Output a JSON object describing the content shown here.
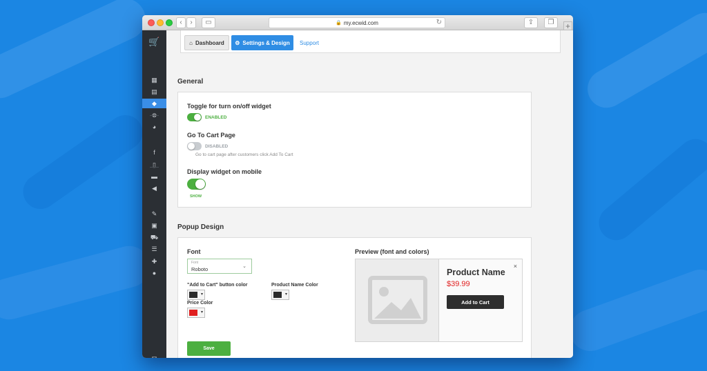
{
  "browser": {
    "url": "my.ecwid.com",
    "back_icon": "‹",
    "forward_icon": "›",
    "sidebar_toggle_icon": "▭",
    "reload_icon": "↻",
    "share_icon": "⇪",
    "tabs_icon": "❐",
    "new_tab_icon": "+"
  },
  "sidebar": {
    "logo_icon": "🛒",
    "items": [
      {
        "name": "store-icon",
        "glyph": "▦"
      },
      {
        "name": "catalog-icon",
        "glyph": "▤"
      },
      {
        "name": "tag-icon",
        "glyph": "◆",
        "active": true
      },
      {
        "name": "marketing-icon",
        "glyph": "⊗"
      },
      {
        "name": "reports-icon",
        "glyph": "◕"
      },
      {
        "name": "facebook-icon",
        "glyph": "f"
      },
      {
        "name": "mobile-icon",
        "glyph": "▯"
      },
      {
        "name": "pos-icon",
        "glyph": "▬"
      },
      {
        "name": "announce-icon",
        "glyph": "◀"
      },
      {
        "name": "design-brush-icon",
        "glyph": "✎"
      },
      {
        "name": "payment-icon",
        "glyph": "▣"
      },
      {
        "name": "shipping-icon",
        "glyph": "⛟"
      },
      {
        "name": "settings-sliders-icon",
        "glyph": "☰"
      },
      {
        "name": "apps-puzzle-icon",
        "glyph": "✚"
      },
      {
        "name": "account-icon",
        "glyph": "●"
      }
    ],
    "mail_icon": "✉"
  },
  "topnav": {
    "dashboard_icon": "⌂",
    "dashboard_label": "Dashboard",
    "settings_icon": "⚙",
    "settings_label": "Settings & Design",
    "support_label": "Support"
  },
  "general": {
    "title": "General",
    "toggle_widget": {
      "label": "Toggle for turn on/off widget",
      "state": "ENABLED",
      "on": true
    },
    "cart_page": {
      "label": "Go To Cart Page",
      "state": "DISABLED",
      "on": false,
      "hint": "Go to cart page after customers click Add To Cart"
    },
    "mobile": {
      "label": "Display widget on mobile",
      "state": "SHOW",
      "on": true
    }
  },
  "popup": {
    "title": "Popup Design",
    "font_label": "Font",
    "font_select_caption": "Font",
    "font_select_value": "Roboto",
    "chevron_icon": "⌄",
    "add_to_cart_color_label": "\"Add to Cart\" button color",
    "add_to_cart_color": "#2b2b2b",
    "product_name_color_label": "Product Name Color",
    "product_name_color": "#2b2b2b",
    "price_color_label": "Price Color",
    "price_color": "#e02020",
    "dropdown_arrow": "▾",
    "save_label": "Save",
    "preview": {
      "title": "Preview (font and colors)",
      "product_name": "Product Name",
      "price": "$39.99",
      "button_label": "Add to Cart",
      "close_icon": "×"
    }
  },
  "colors": {
    "accent": "#2f8de4",
    "toggle_on": "#4caf40",
    "toggle_off": "#c8ccd0",
    "desktop_bg": "#1b86e3"
  }
}
